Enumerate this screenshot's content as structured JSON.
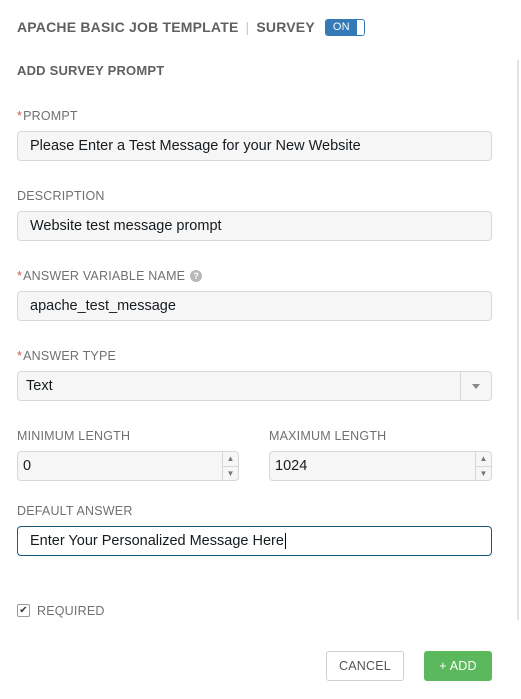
{
  "header": {
    "template_name": "APACHE BASIC JOB TEMPLATE",
    "separator": "|",
    "section": "SURVEY",
    "toggle_label": "ON"
  },
  "form": {
    "title": "ADD SURVEY PROMPT",
    "required_marker": "*",
    "prompt": {
      "label": "PROMPT",
      "value": "Please Enter a Test Message for your New Website"
    },
    "description": {
      "label": "DESCRIPTION",
      "value": "Website test message prompt"
    },
    "variable_name": {
      "label": "ANSWER VARIABLE NAME",
      "help_icon": "?",
      "value": "apache_test_message"
    },
    "answer_type": {
      "label": "ANSWER TYPE",
      "value": "Text"
    },
    "min_length": {
      "label": "MINIMUM LENGTH",
      "value": "0"
    },
    "max_length": {
      "label": "MAXIMUM LENGTH",
      "value": "1024"
    },
    "default_answer": {
      "label": "DEFAULT ANSWER",
      "value": "Enter Your Personalized Message Here"
    },
    "required": {
      "label": "REQUIRED",
      "checked": true,
      "check_glyph": "✔"
    }
  },
  "actions": {
    "cancel_label": "CANCEL",
    "add_label": "+ ADD"
  },
  "icons": {
    "stepper_up": "▲",
    "stepper_down": "▼",
    "dropdown": "chevron-down-icon",
    "help": "question-circle-icon",
    "checkbox": "checkmark-icon"
  },
  "colors": {
    "required": "#d9534f",
    "toggle": "#337ab7",
    "add_button": "#5cb85c",
    "focus_border": "#1a5a7a"
  }
}
